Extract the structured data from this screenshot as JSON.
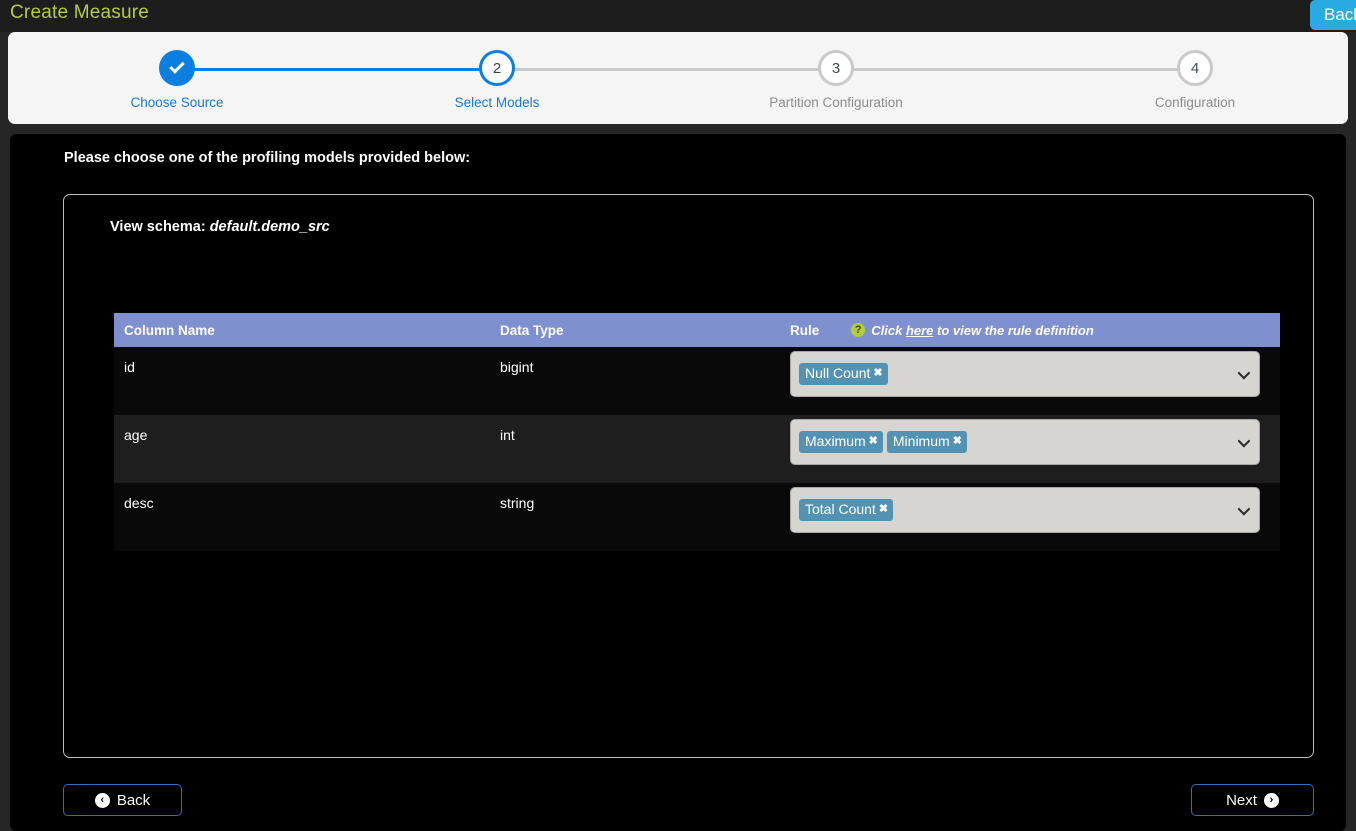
{
  "topbar": {
    "title": "Create Measure",
    "back_label": "Back"
  },
  "stepper": {
    "steps": [
      {
        "number": "1",
        "label": "Choose Source",
        "state": "done"
      },
      {
        "number": "2",
        "label": "Select Models",
        "state": "active"
      },
      {
        "number": "3",
        "label": "Partition Configuration",
        "state": "todo"
      },
      {
        "number": "4",
        "label": "Configuration",
        "state": "todo"
      }
    ],
    "active_color": "#0b7fe0",
    "inactive_color": "#c9c9c9"
  },
  "main": {
    "instruction": "Please choose one of the profiling models provided below:",
    "schema_label": "View schema:",
    "schema_name": "default.demo_src",
    "table": {
      "headers": {
        "column_name": "Column Name",
        "data_type": "Data Type",
        "rule": "Rule",
        "rule_hint_prefix": "Click ",
        "rule_hint_link": "here",
        "rule_hint_suffix": " to view the rule definition",
        "help_icon": "question-mark-icon",
        "help_icon_color": "#b5cd3c",
        "header_bg": "#7f90d1"
      },
      "rows": [
        {
          "column_name": "id",
          "data_type": "bigint",
          "rules": [
            "Null Count"
          ]
        },
        {
          "column_name": "age",
          "data_type": "int",
          "rules": [
            "Maximum",
            "Minimum"
          ]
        },
        {
          "column_name": "desc",
          "data_type": "string",
          "rules": [
            "Total Count"
          ]
        }
      ],
      "tag_color": "#5292b3",
      "tag_remove_glyph": "✖",
      "dropdown_bg": "#d7d5d1",
      "dropdown_chevron": "chevron-down-icon"
    }
  },
  "footer": {
    "back_label": "Back",
    "next_label": "Next",
    "back_icon": "arrow-left-circle-icon",
    "next_icon": "arrow-right-circle-icon"
  }
}
